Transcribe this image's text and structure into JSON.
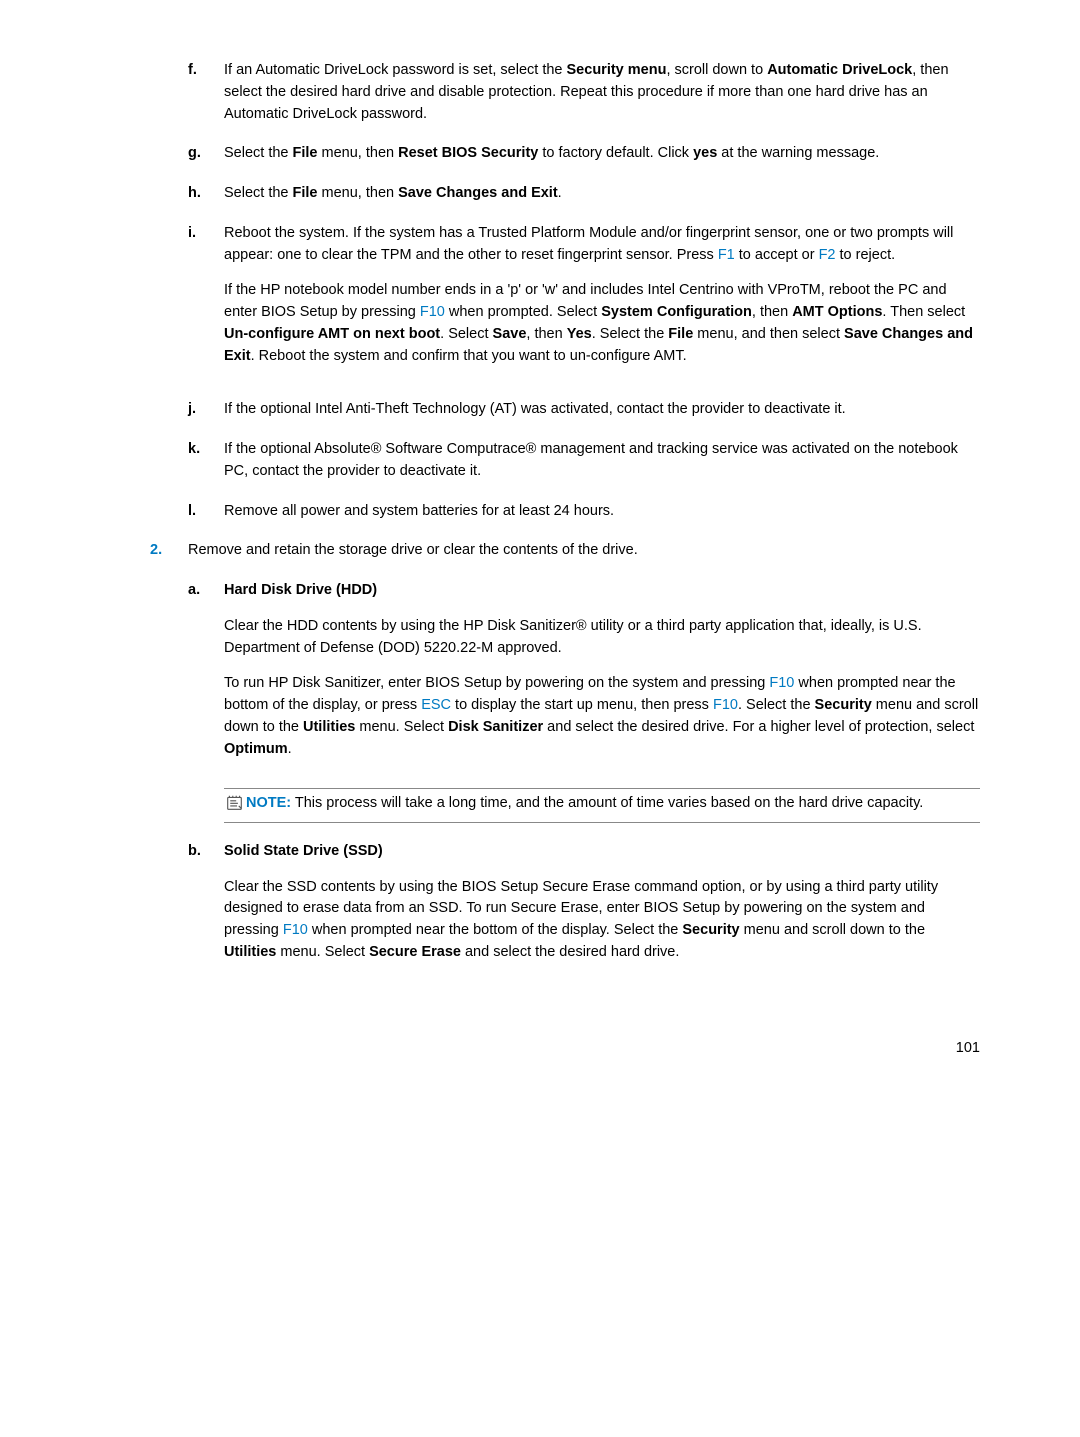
{
  "steps_level1_continued": [
    {
      "marker": "f.",
      "html": "If an Automatic DriveLock password is set, select the <b>Security menu</b>, scroll down to <b>Automatic DriveLock</b>, then select the desired hard drive and disable protection. Repeat this procedure if more than one hard drive has an Automatic DriveLock password."
    },
    {
      "marker": "g.",
      "html": "Select the <b>File</b> menu, then <b>Reset BIOS Security</b> to factory default. Click <b>yes</b> at the warning message."
    },
    {
      "marker": "h.",
      "html": "Select the <b>File</b> menu, then <b>Save Changes and Exit</b>."
    },
    {
      "marker": "i.",
      "paras": [
        "Reboot the system. If the system has a Trusted Platform Module and/or fingerprint sensor, one or two prompts will appear: one to clear the TPM and the other to reset fingerprint sensor. Press <span class=\"key\">F1</span> to accept or <span class=\"key\">F2</span> to reject.",
        "If the HP notebook model number ends in a 'p' or 'w' and includes Intel Centrino with VProTM, reboot the PC and enter BIOS Setup by pressing <span class=\"key\">F10</span> when prompted. Select <b>System Configuration</b>, then <b>AMT Options</b>. Then select <b>Un-configure AMT on next boot</b>. Select <b>Save</b>, then <b>Yes</b>. Select the <b>File</b> menu, and then select <b>Save Changes and Exit</b>. Reboot the system and confirm that you want to un-configure AMT."
      ]
    },
    {
      "marker": "j.",
      "html": "If the optional Intel Anti-Theft Technology (AT) was activated, contact the provider to deactivate it."
    },
    {
      "marker": "k.",
      "html": "If the optional Absolute® Software Computrace® management and tracking service was activated on the notebook PC, contact the provider to deactivate it."
    },
    {
      "marker": "l.",
      "html": "Remove all power and system batteries for at least 24 hours."
    }
  ],
  "step2": {
    "marker": "2.",
    "text": "Remove and retain the storage drive or clear the contents of the drive.",
    "sub": [
      {
        "marker": "a.",
        "title": "Hard Disk Drive (HDD)",
        "paras": [
          "Clear the HDD contents by using the HP Disk Sanitizer® utility or a third party application that, ideally, is U.S. Department of Defense (DOD) 5220.22-M approved.",
          "To run HP Disk Sanitizer, enter BIOS Setup by powering on the system and pressing <span class=\"key\">F10</span> when prompted near the bottom of the display, or press <span class=\"key\">ESC</span> to display the start up menu, then press <span class=\"key\">F10</span>. Select the <b>Security</b> menu and scroll down to the <b>Utilities</b> menu. Select <b>Disk Sanitizer</b> and select the desired drive. For a higher level of protection, select <b>Optimum</b>."
        ]
      },
      {
        "marker": "b.",
        "title": "Solid State Drive (SSD)",
        "paras": [
          "Clear the SSD contents by using the BIOS Setup Secure Erase command option, or by using a third party utility designed to erase data from an SSD. To run Secure Erase, enter BIOS Setup by powering on the system and pressing <span class=\"key\">F10</span> when prompted near the bottom of the display. Select the <b>Security</b> menu and scroll down to the <b>Utilities</b> menu. Select <b>Secure Erase</b> and select the desired hard drive."
        ]
      }
    ]
  },
  "note": {
    "label": "NOTE:",
    "text": "This process will take a long time, and the amount of time varies based on the hard drive capacity."
  },
  "page_number": "101"
}
